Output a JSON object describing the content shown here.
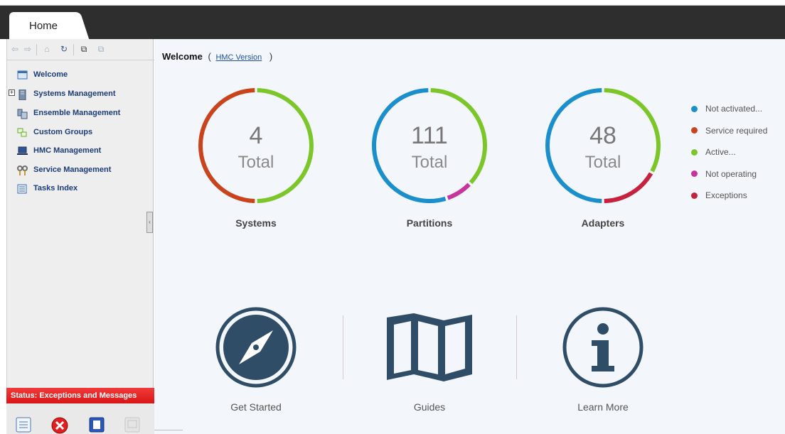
{
  "header": {
    "home_tab": "Home"
  },
  "sidebar": {
    "items": [
      {
        "label": "Welcome",
        "icon": "window-icon"
      },
      {
        "label": "Systems Management",
        "icon": "server-icon"
      },
      {
        "label": "Ensemble Management",
        "icon": "ensemble-icon"
      },
      {
        "label": "Custom Groups",
        "icon": "groups-icon"
      },
      {
        "label": "HMC Management",
        "icon": "laptop-icon"
      },
      {
        "label": "Service Management",
        "icon": "tools-icon"
      },
      {
        "label": "Tasks Index",
        "icon": "list-icon"
      }
    ],
    "status_label": "Status: Exceptions and Messages"
  },
  "main": {
    "welcome": "Welcome",
    "open_paren": "(",
    "hmc_version": "HMC Version",
    "close_paren": ")",
    "total_word": "Total"
  },
  "colors": {
    "not_activated": "#1a8fcb",
    "service_required": "#c9441c",
    "active": "#7cc62a",
    "not_operating": "#c7349b",
    "exceptions": "#c6223d"
  },
  "chart_data": [
    {
      "type": "pie",
      "label": "Systems",
      "total": "4",
      "segments": [
        {
          "status": "Active...",
          "fraction": 0.5
        },
        {
          "status": "Service required",
          "fraction": 0.5
        }
      ]
    },
    {
      "type": "pie",
      "label": "Partitions",
      "total": "111",
      "segments": [
        {
          "status": "Active...",
          "fraction": 0.37
        },
        {
          "status": "Not operating",
          "fraction": 0.08
        },
        {
          "status": "Not activated...",
          "fraction": 0.55
        }
      ]
    },
    {
      "type": "pie",
      "label": "Adapters",
      "total": "48",
      "segments": [
        {
          "status": "Active...",
          "fraction": 0.33
        },
        {
          "status": "Exceptions",
          "fraction": 0.17
        },
        {
          "status": "Not activated...",
          "fraction": 0.5
        }
      ]
    }
  ],
  "legend": [
    {
      "label": "Not activated...",
      "color": "#1a8fcb"
    },
    {
      "label": "Service required",
      "color": "#c9441c"
    },
    {
      "label": "Active...",
      "color": "#7cc62a"
    },
    {
      "label": "Not operating",
      "color": "#c7349b"
    },
    {
      "label": "Exceptions",
      "color": "#c6223d"
    }
  ],
  "links": [
    {
      "label": "Get Started",
      "icon": "compass-icon"
    },
    {
      "label": "Guides",
      "icon": "map-icon"
    },
    {
      "label": "Learn More",
      "icon": "info-icon"
    }
  ]
}
